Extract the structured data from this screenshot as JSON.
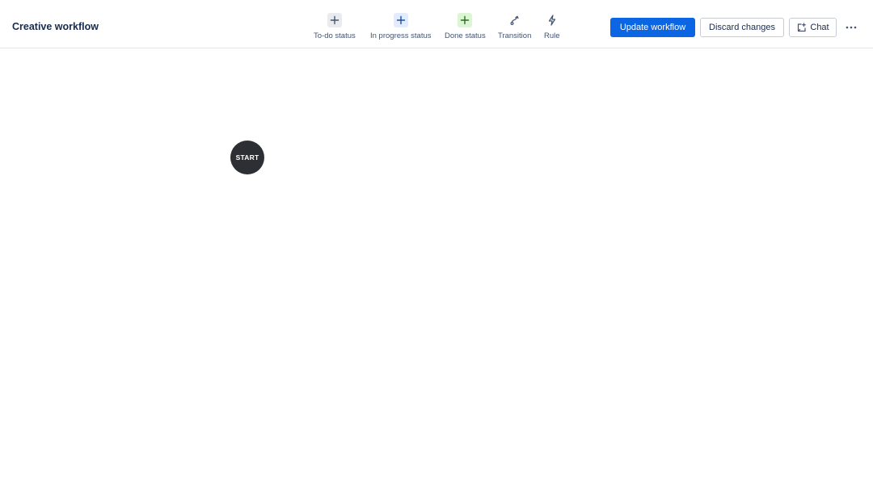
{
  "header": {
    "title": "Creative workflow"
  },
  "toolbar": {
    "items": [
      {
        "label": "To-do status",
        "icon": "plus-icon",
        "bg": "#e9ebee",
        "color": "#44546f"
      },
      {
        "label": "In progress status",
        "icon": "plus-icon",
        "bg": "#e1ecfe",
        "color": "#1d4fa6"
      },
      {
        "label": "Done status",
        "icon": "plus-icon",
        "bg": "#dcf5d3",
        "color": "#2f6b1e"
      },
      {
        "label": "Transition",
        "icon": "transition-icon"
      },
      {
        "label": "Rule",
        "icon": "lightning-icon"
      }
    ]
  },
  "actions": {
    "update_label": "Update workflow",
    "discard_label": "Discard changes",
    "chat_label": "Chat",
    "more_icon": "more-horizontal-icon"
  },
  "canvas": {
    "start_label": "START"
  },
  "colors": {
    "primary": "#0c66e4",
    "start_node": "#2c2f33"
  }
}
